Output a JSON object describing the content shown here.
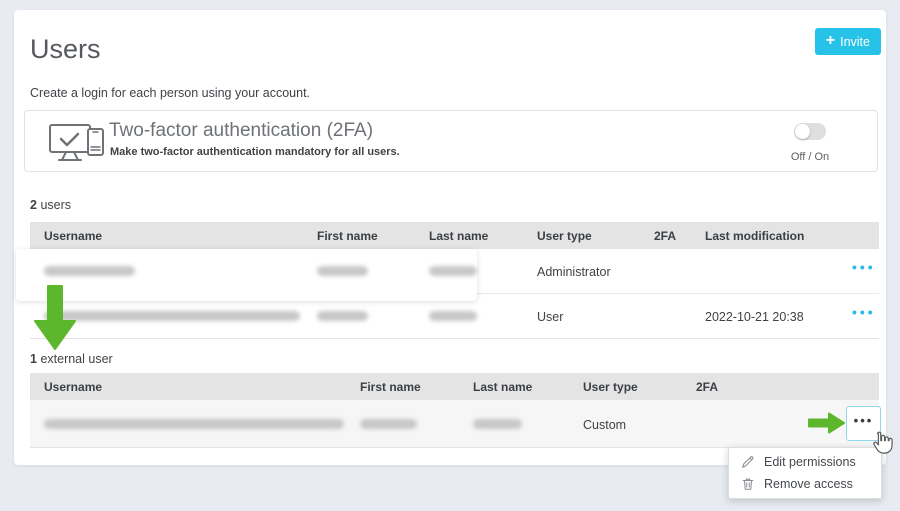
{
  "header": {
    "title": "Users",
    "subtitle": "Create a login for each person using your account.",
    "invite_plus": "+",
    "invite_label": "Invite"
  },
  "twofa_panel": {
    "title": "Two-factor authentication (2FA)",
    "description": "Make two-factor authentication mandatory for all users.",
    "toggle_label": "Off / On",
    "toggle_state": "off"
  },
  "users_table": {
    "count": "2",
    "count_suffix": "users",
    "columns": [
      "Username",
      "First name",
      "Last name",
      "User type",
      "2FA",
      "Last modification"
    ],
    "ellipsis": "•••",
    "rows": [
      {
        "redacted": true,
        "user_type": "Administrator",
        "twofa": "",
        "last_modification": ""
      },
      {
        "redacted": true,
        "user_type": "User",
        "twofa": "",
        "last_modification": "2022-10-21 20:38"
      }
    ]
  },
  "external_table": {
    "count": "1",
    "count_suffix": "external user",
    "columns": [
      "Username",
      "First name",
      "Last name",
      "User type",
      "2FA"
    ],
    "ellipsis": "•••",
    "rows": [
      {
        "redacted": true,
        "user_type": "Custom",
        "twofa": ""
      }
    ]
  },
  "context_menu": {
    "items": [
      {
        "icon": "pencil-icon",
        "label": "Edit permissions"
      },
      {
        "icon": "trash-icon",
        "label": "Remove access"
      }
    ]
  },
  "colors": {
    "accent": "#27c2e8",
    "annotation_green": "#5db72d",
    "page_background": "#e8ecf2",
    "table_header_background": "#e4e4e4"
  }
}
